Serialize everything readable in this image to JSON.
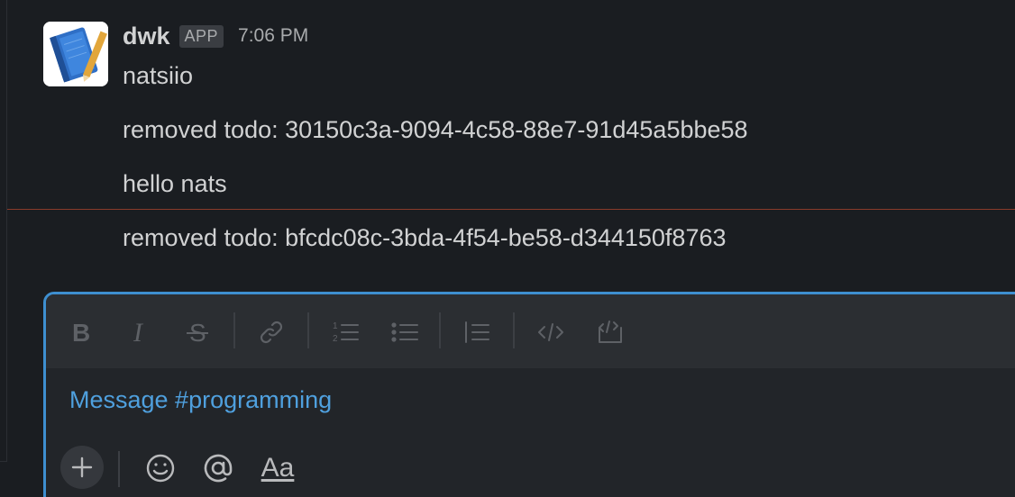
{
  "message_group": {
    "author": "dwk",
    "badge": "APP",
    "time": "7:06 PM",
    "avatar_icon": "notebook-icon",
    "messages": [
      "natsiio",
      "removed todo: 30150c3a-9094-4c58-88e7-91d45a5bbe58",
      "hello nats",
      "removed todo: bfcdc08c-3bda-4f54-be58-d344150f8763"
    ]
  },
  "composer": {
    "placeholder": "Message #programming",
    "format_icons": [
      "bold-icon",
      "italic-icon",
      "strikethrough-icon",
      "link-icon",
      "ordered-list-icon",
      "bulleted-list-icon",
      "blockquote-icon",
      "code-icon",
      "code-block-icon"
    ],
    "bottom_icons": [
      "plus-icon",
      "emoji-icon",
      "mention-icon",
      "format-text-icon"
    ],
    "format_text_label": "Aa"
  },
  "colors": {
    "background": "#1a1d21",
    "accent": "#3e8fd0",
    "placeholder": "#4fa0de",
    "new_divider": "#8a3b2b"
  }
}
